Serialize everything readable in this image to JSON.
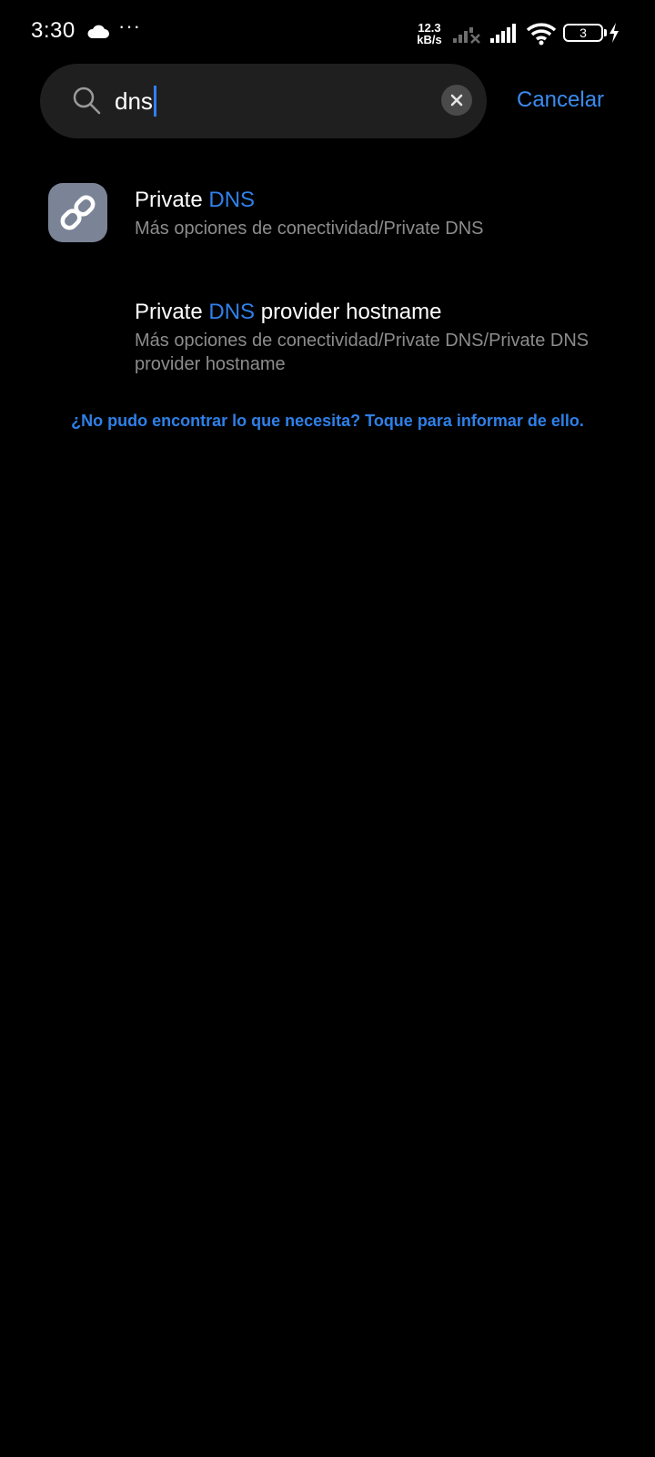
{
  "status_bar": {
    "time": "3:30",
    "more_indicator": "···",
    "net_speed_value": "12.3",
    "net_speed_unit": "kB/s",
    "battery_level": "3",
    "icons": [
      "cloud-icon",
      "signal-off-icon",
      "signal-icon",
      "wifi-icon",
      "battery-icon",
      "charging-bolt-icon"
    ]
  },
  "search": {
    "query": "dns",
    "cancel_label": "Cancelar",
    "icons": [
      "search-icon",
      "clear-icon"
    ]
  },
  "results": [
    {
      "title_prefix": "Private ",
      "title_highlight": "DNS",
      "title_suffix": "",
      "path": "Más opciones de conectividad/Private DNS",
      "icon": "link-icon"
    },
    {
      "title_prefix": "Private ",
      "title_highlight": "DNS",
      "title_suffix": " provider hostname",
      "path": "Más opciones de conectividad/Private DNS/Private DNS provider hostname"
    }
  ],
  "report_link": "¿No pudo encontrar lo que necesita? Toque para informar de ello.",
  "colors": {
    "background": "#000000",
    "search_box": "#1f1f1f",
    "accent": "#2f80e8",
    "secondary_text": "#8c8c8c",
    "icon_tile": "#7b8496"
  }
}
